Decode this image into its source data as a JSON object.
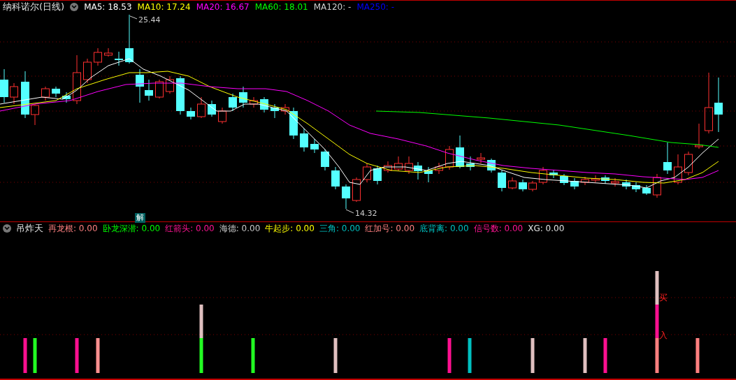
{
  "header": {
    "title": "纳科诺尔(日线)",
    "averages": [
      {
        "text": "MA5: 18.53",
        "color": "#ffffff"
      },
      {
        "text": "MA10: 17.24",
        "color": "#ffff00"
      },
      {
        "text": "MA20: 16.67",
        "color": "#ff00ff"
      },
      {
        "text": "MA60: 18.01",
        "color": "#00ff00"
      },
      {
        "text": "MA120: -",
        "color": "#d0d0d0"
      },
      {
        "text": "MA250: -",
        "color": "#0000ff"
      }
    ]
  },
  "chart": {
    "high_label": "25.44",
    "low_label": "14.32",
    "badge": "解"
  },
  "indicator": {
    "title": "吊炸天",
    "items": [
      {
        "text": "再龙根: 0.00",
        "color": "#ff8080"
      },
      {
        "text": "卧龙深潜: 0.00",
        "color": "#00ff00"
      },
      {
        "text": "红箭头: 0.00",
        "color": "#ff1493"
      },
      {
        "text": "海德: 0.00",
        "color": "#c8c8c8"
      },
      {
        "text": "牛起步: 0.00",
        "color": "#ffff00"
      },
      {
        "text": "三角: 0.00",
        "color": "#00c0c0"
      },
      {
        "text": "红加号: 0.00",
        "color": "#ff8080"
      },
      {
        "text": "底背离: 0.00",
        "color": "#00c0c0"
      },
      {
        "text": "信号数: 0.00",
        "color": "#ff1493"
      },
      {
        "text": "XG: 0.00",
        "color": "#e0e0e0"
      }
    ],
    "signals": [
      "买",
      "入"
    ]
  }
}
